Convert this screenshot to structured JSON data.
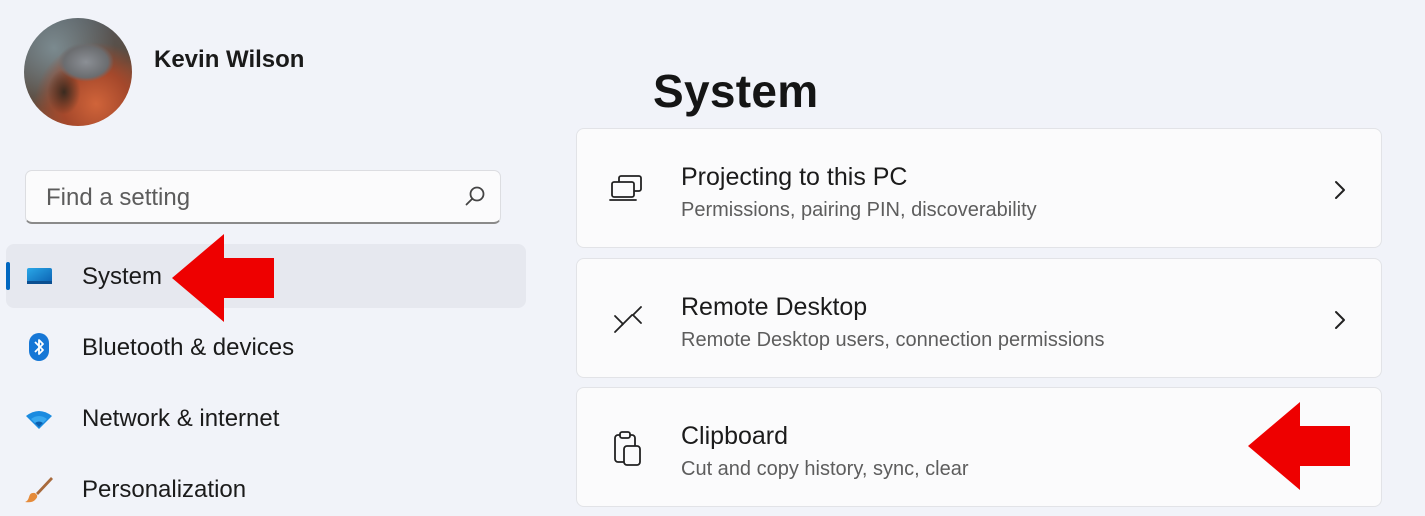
{
  "user": {
    "name": "Kevin Wilson"
  },
  "search": {
    "placeholder": "Find a setting",
    "icon": "search-icon"
  },
  "sidebar": {
    "items": [
      {
        "label": "System",
        "icon": "system-display-icon",
        "selected": true
      },
      {
        "label": "Bluetooth & devices",
        "icon": "bluetooth-icon",
        "selected": false
      },
      {
        "label": "Network & internet",
        "icon": "wifi-icon",
        "selected": false
      },
      {
        "label": "Personalization",
        "icon": "brush-icon",
        "selected": false
      }
    ]
  },
  "main": {
    "title": "System",
    "cards": [
      {
        "title": "Projecting to this PC",
        "subtitle": "Permissions, pairing PIN, discoverability",
        "icon": "projecting-icon"
      },
      {
        "title": "Remote Desktop",
        "subtitle": "Remote Desktop users, connection permissions",
        "icon": "remote-desktop-icon"
      },
      {
        "title": "Clipboard",
        "subtitle": "Cut and copy history, sync, clear",
        "icon": "clipboard-icon"
      }
    ]
  },
  "colors": {
    "background": "#f1f3f9",
    "accent": "#0067c0",
    "annotation_arrow": "#ee0000"
  }
}
